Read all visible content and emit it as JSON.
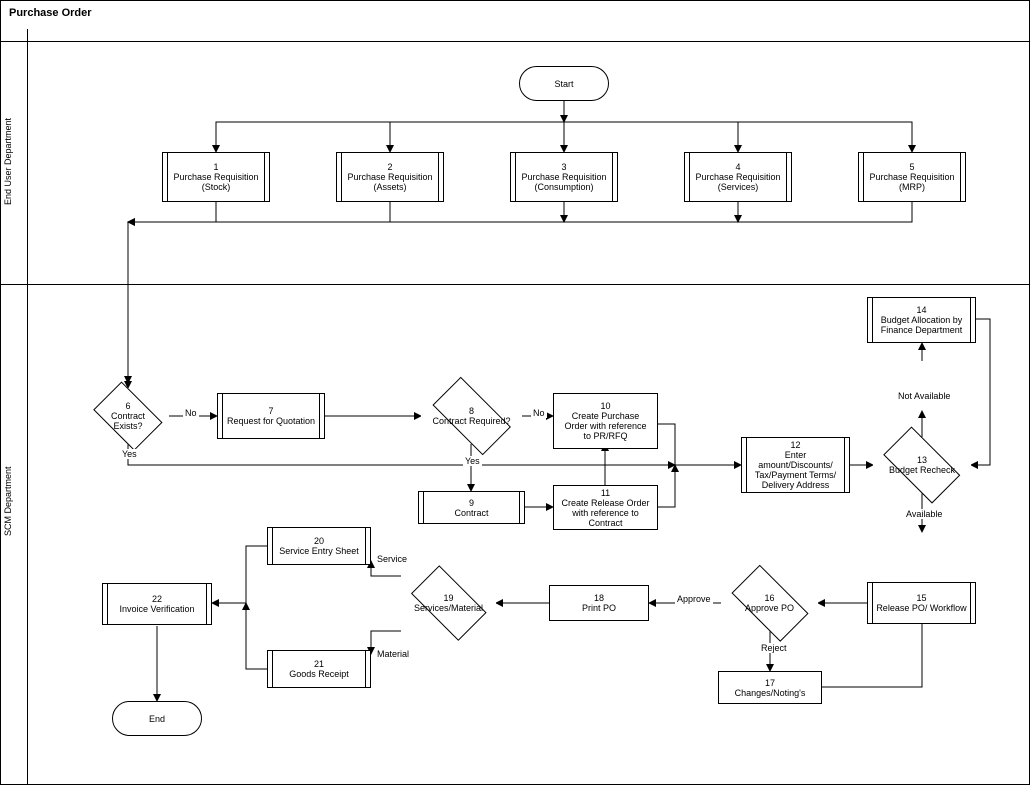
{
  "title": "Purchase Order",
  "lanes": {
    "top": "End User Department",
    "bottom": "SCM Department"
  },
  "start": "Start",
  "end": "End",
  "nodes": {
    "n1": {
      "num": "1",
      "label": "Purchase Requisition (Stock)"
    },
    "n2": {
      "num": "2",
      "label": "Purchase Requisition (Assets)"
    },
    "n3": {
      "num": "3",
      "label": "Purchase Requisition (Consumption)"
    },
    "n4": {
      "num": "4",
      "label": "Purchase Requisition (Services)"
    },
    "n5": {
      "num": "5",
      "label": "Purchase Requisition (MRP)"
    },
    "n6": {
      "num": "6",
      "label": "Contract Exists?"
    },
    "n7": {
      "num": "7",
      "label": "Request for Quotation"
    },
    "n8": {
      "num": "8",
      "label": "Contract Required?"
    },
    "n9": {
      "num": "9",
      "label": "Contract"
    },
    "n10": {
      "num": "10",
      "label": "Create Purchase Order with reference to PR/RFQ"
    },
    "n11": {
      "num": "11",
      "label": "Create Release Order with reference to Contract"
    },
    "n12": {
      "num": "12",
      "label": "Enter amount/Discounts/ Tax/Payment Terms/ Delivery Address"
    },
    "n13": {
      "num": "13",
      "label": "Budget Recheck"
    },
    "n14": {
      "num": "14",
      "label": "Budget Allocation by Finance Department"
    },
    "n15": {
      "num": "15",
      "label": "Release PO/ Workflow"
    },
    "n16": {
      "num": "16",
      "label": "Approve PO"
    },
    "n17": {
      "num": "17",
      "label": "Changes/Noting's"
    },
    "n18": {
      "num": "18",
      "label": "Print PO"
    },
    "n19": {
      "num": "19",
      "label": "Services/Material"
    },
    "n20": {
      "num": "20",
      "label": "Service Entry Sheet"
    },
    "n21": {
      "num": "21",
      "label": "Goods Receipt"
    },
    "n22": {
      "num": "22",
      "label": "Invoice Verification"
    }
  },
  "labels": {
    "no": "No",
    "yes": "Yes",
    "available": "Available",
    "notavail": "Not Available",
    "approve": "Approve",
    "reject": "Reject",
    "service": "Service",
    "material": "Material"
  }
}
